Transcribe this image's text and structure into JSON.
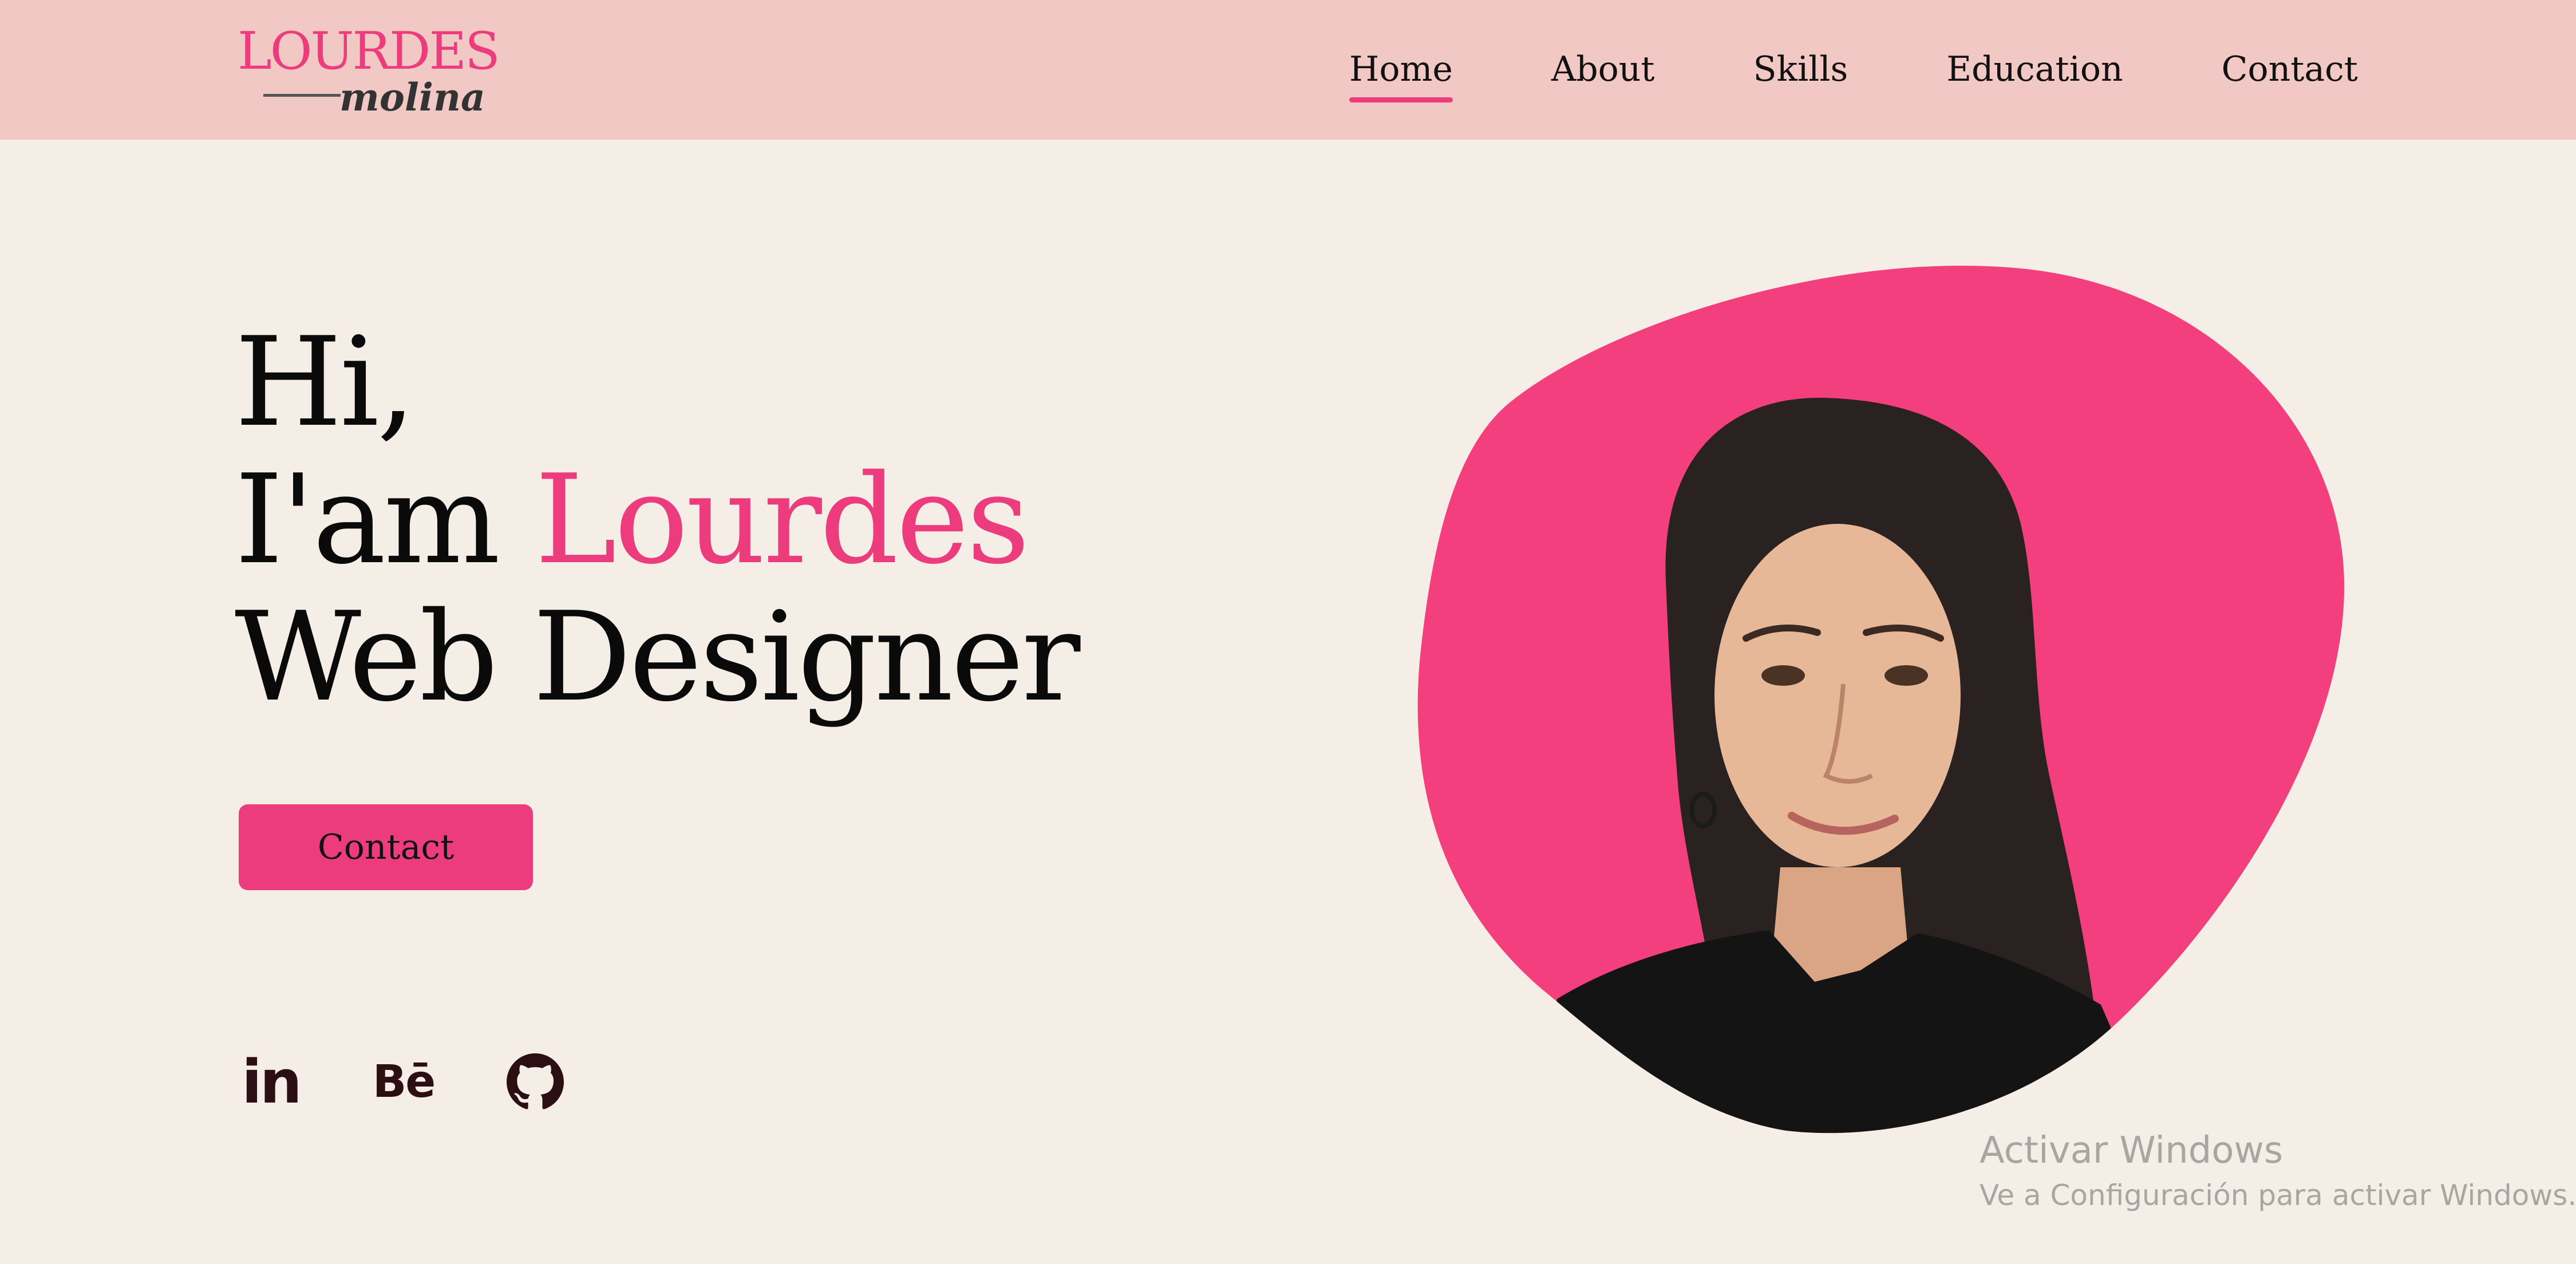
{
  "header": {
    "logo": {
      "name": "LOURDES",
      "surname": "molina"
    },
    "nav": [
      {
        "label": "Home",
        "active": true
      },
      {
        "label": "About",
        "active": false
      },
      {
        "label": "Skills",
        "active": false
      },
      {
        "label": "Education",
        "active": false
      },
      {
        "label": "Contact",
        "active": false
      }
    ]
  },
  "hero": {
    "greeting": "Hi,",
    "intro_prefix": "I'am ",
    "name": "Lourdes",
    "role": "Web Designer",
    "contact_button": "Contact"
  },
  "social": {
    "linkedin_label": "in",
    "behance_label": "Bē",
    "icons": [
      "linkedin-icon",
      "behance-icon",
      "github-icon"
    ]
  },
  "watermark": {
    "title": "Activar Windows",
    "subtitle": "Ve a Configuración para activar Windows."
  },
  "colors": {
    "accent": "#ec3c7d",
    "header_bg": "#f2c8c4",
    "page_bg": "#f5eee7",
    "text": "#0a0a0a"
  }
}
